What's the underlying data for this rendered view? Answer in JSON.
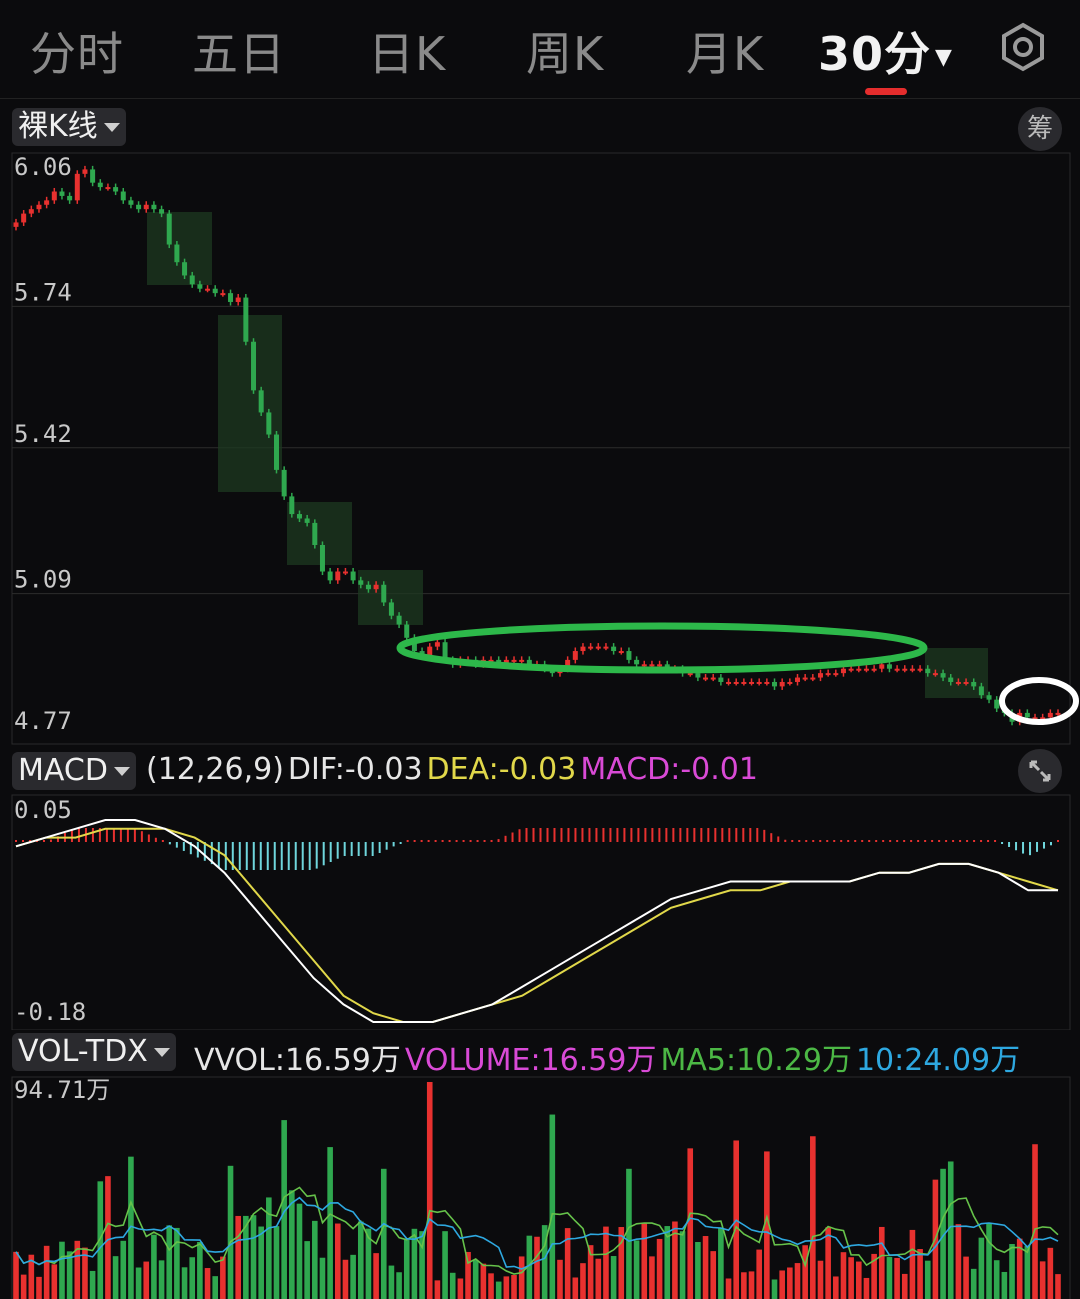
{
  "tabs": [
    {
      "label": "分时"
    },
    {
      "label": "五日"
    },
    {
      "label": "日K"
    },
    {
      "label": "周K"
    },
    {
      "label": "月K"
    },
    {
      "label": "30分"
    }
  ],
  "active_tab": "30分",
  "icons": {
    "settings": "gear-icon",
    "chips": "筹",
    "expand": "expand-icon"
  },
  "price_panel": {
    "mode_label": "裸K线",
    "y_ticks": [
      "6.06",
      "5.74",
      "5.42",
      "5.09",
      "4.77"
    ]
  },
  "macd_panel": {
    "name": "MACD",
    "params": "(12,26,9)",
    "dif": "DIF:-0.03",
    "dea": "DEA:-0.03",
    "macd": "MACD:-0.01",
    "y_top": "0.05",
    "y_bottom": "-0.18"
  },
  "vol_panel": {
    "name": "VOL-TDX",
    "vvol": "VVOL:16.59万",
    "volume": "VOLUME:16.59万",
    "ma5": "MA5:10.29万",
    "ma10": "10:24.09万",
    "y_top": "94.71万"
  },
  "colors": {
    "up": "#e8312f",
    "down": "#2fa84f",
    "dif": "#ffffff",
    "dea": "#e1d84a",
    "hist_neg": "#6fd6dc",
    "ma5": "#66c24a",
    "ma10": "#2ea8e0",
    "highlight_oval": "#2db84a",
    "vvol_text": "#e6e6e6",
    "volume_text": "#d94ad6",
    "dea_text": "#e1d84a",
    "macd_text": "#d94ad6",
    "ma5_text": "#4cb845",
    "ma10_text": "#2ea8e0"
  },
  "chart_data": [
    {
      "type": "candlestick",
      "ylim": [
        4.77,
        6.06
      ],
      "close": [
        5.93,
        5.95,
        5.96,
        5.97,
        5.98,
        6.0,
        5.99,
        5.98,
        6.04,
        6.05,
        6.02,
        6.01,
        6.01,
        6.0,
        5.98,
        5.97,
        5.96,
        5.97,
        5.96,
        5.95,
        5.88,
        5.84,
        5.81,
        5.79,
        5.78,
        5.78,
        5.77,
        5.77,
        5.75,
        5.76,
        5.66,
        5.55,
        5.5,
        5.45,
        5.37,
        5.31,
        5.27,
        5.26,
        5.25,
        5.2,
        5.14,
        5.12,
        5.14,
        5.14,
        5.12,
        5.11,
        5.1,
        5.11,
        5.07,
        5.04,
        5.02,
        4.99,
        4.96,
        4.95,
        4.97,
        4.98,
        4.94,
        4.93,
        4.94,
        4.94,
        4.93,
        4.94,
        4.94,
        4.93,
        4.94,
        4.94,
        4.94,
        4.93,
        4.93,
        4.92,
        4.91,
        4.92,
        4.94,
        4.96,
        4.97,
        4.97,
        4.97,
        4.97,
        4.96,
        4.96,
        4.94,
        4.93,
        4.93,
        4.93,
        4.93,
        4.92,
        4.92,
        4.91,
        4.91,
        4.9,
        4.9,
        4.9,
        4.89,
        4.89,
        4.89,
        4.89,
        4.89,
        4.89,
        4.89,
        4.88,
        4.89,
        4.89,
        4.9,
        4.9,
        4.9,
        4.91,
        4.91,
        4.91,
        4.92,
        4.92,
        4.92,
        4.92,
        4.92,
        4.93,
        4.92,
        4.92,
        4.92,
        4.92,
        4.92,
        4.91,
        4.91,
        4.9,
        4.89,
        4.89,
        4.89,
        4.88,
        4.86,
        4.85,
        4.83,
        4.82,
        4.8,
        4.82,
        4.81,
        4.81,
        4.81,
        4.82,
        4.82
      ]
    },
    {
      "type": "line",
      "series": [
        {
          "name": "DIF",
          "values": [
            0.02,
            0.03,
            0.04,
            0.05,
            0.05,
            0.04,
            0.02,
            -0.01,
            -0.05,
            -0.09,
            -0.13,
            -0.16,
            -0.18,
            -0.18,
            -0.18,
            -0.17,
            -0.16,
            -0.14,
            -0.12,
            -0.1,
            -0.08,
            -0.06,
            -0.04,
            -0.03,
            -0.02,
            -0.02,
            -0.02,
            -0.02,
            -0.02,
            -0.01,
            -0.01,
            0.0,
            0.0,
            -0.01,
            -0.03,
            -0.03
          ]
        },
        {
          "name": "DEA",
          "values": [
            0.02,
            0.03,
            0.03,
            0.04,
            0.04,
            0.04,
            0.03,
            0.01,
            -0.03,
            -0.07,
            -0.11,
            -0.15,
            -0.17,
            -0.18,
            -0.18,
            -0.17,
            -0.16,
            -0.15,
            -0.13,
            -0.11,
            -0.09,
            -0.07,
            -0.05,
            -0.04,
            -0.03,
            -0.03,
            -0.02,
            -0.02,
            -0.02,
            -0.01,
            -0.01,
            0.0,
            0.0,
            -0.01,
            -0.02,
            -0.03
          ]
        }
      ],
      "ylim": [
        -0.18,
        0.05
      ]
    },
    {
      "type": "bar",
      "name": "VOL-TDX",
      "ylim": [
        0,
        94.71
      ]
    }
  ]
}
